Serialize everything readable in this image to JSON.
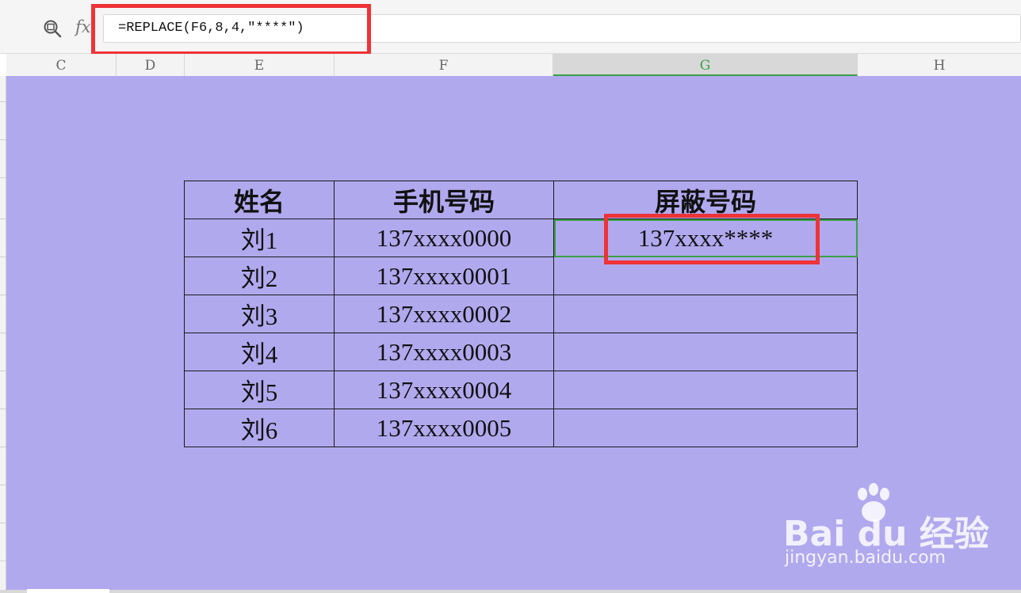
{
  "formula_bar": {
    "formula": "=REPLACE(F6,8,4,\"****\")",
    "fx_label": "fx",
    "zoom_icon": "zoom-formula-icon"
  },
  "columns": [
    {
      "label": "C",
      "active": false
    },
    {
      "label": "D",
      "active": false
    },
    {
      "label": "E",
      "active": false
    },
    {
      "label": "F",
      "active": false
    },
    {
      "label": "G",
      "active": true
    },
    {
      "label": "H",
      "active": false
    }
  ],
  "table": {
    "headers": [
      "姓名",
      "手机号码",
      "屏蔽号码"
    ],
    "rows": [
      [
        "刘1",
        "137xxxx0000",
        "137xxxx****"
      ],
      [
        "刘2",
        "137xxxx0001",
        ""
      ],
      [
        "刘3",
        "137xxxx0002",
        ""
      ],
      [
        "刘4",
        "137xxxx0003",
        ""
      ],
      [
        "刘5",
        "137xxxx0004",
        ""
      ],
      [
        "刘6",
        "137xxxx0005",
        ""
      ]
    ]
  },
  "colors": {
    "sheet_background": "#b1a9ee",
    "highlight_box": "#ee3338",
    "selection": "#3aa046"
  },
  "watermark": {
    "brand": "Bai du 经验",
    "url": "jingyan.baidu.com"
  }
}
